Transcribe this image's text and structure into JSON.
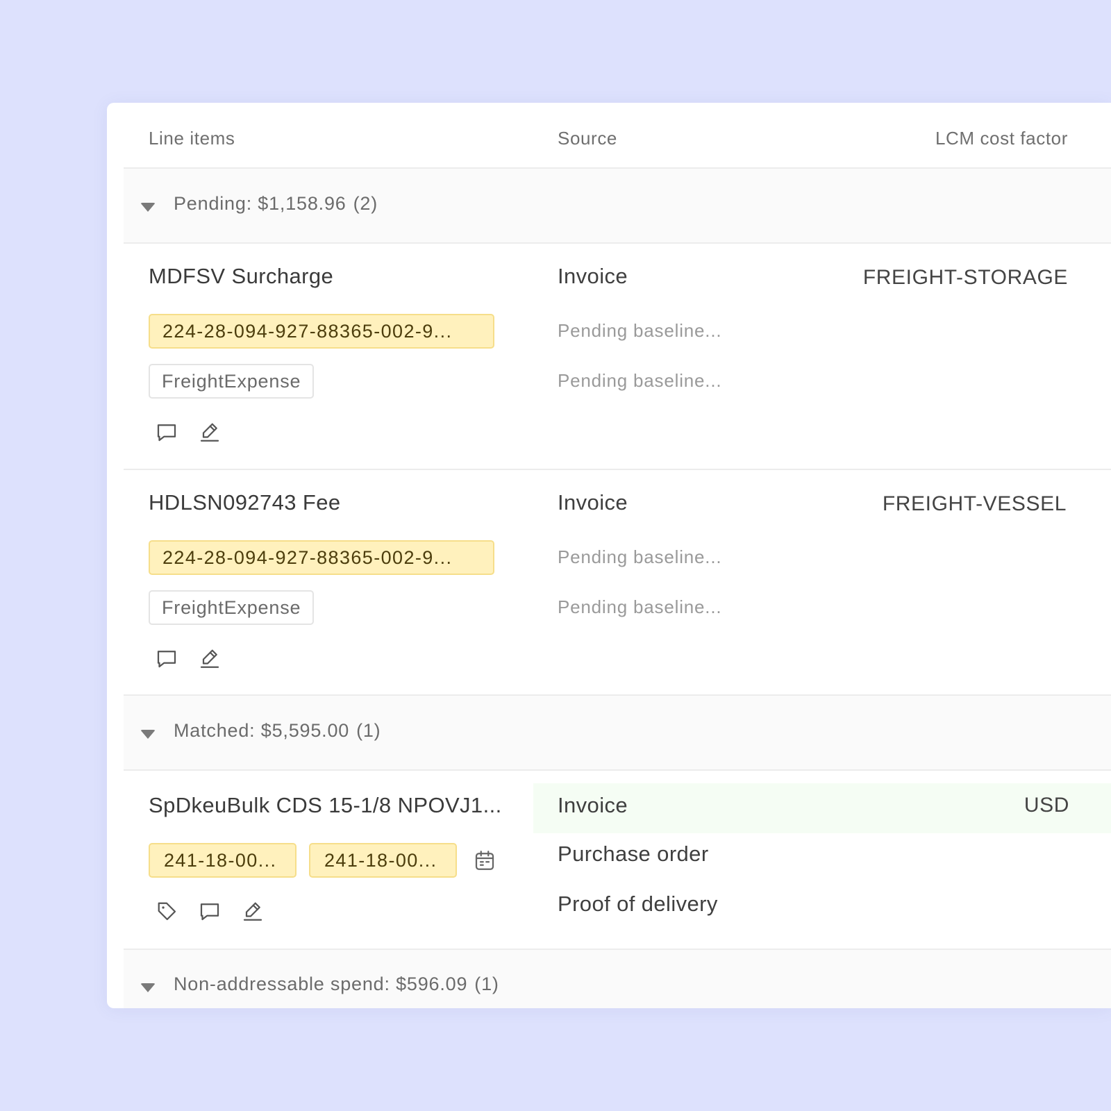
{
  "columns": {
    "line_items": "Line items",
    "source": "Source",
    "lcm_cost_factor": "LCM cost factor"
  },
  "groups": {
    "pending": {
      "label": "Pending: $1,158.96",
      "count": "(2)"
    },
    "matched": {
      "label": "Matched: $5,595.00",
      "count": "(1)"
    },
    "non_addressable": {
      "label": "Non-addressable spend: $596.09",
      "count": "(1)"
    }
  },
  "rows": [
    {
      "title": "MDFSV Surcharge",
      "reference": "224-28-094-927-88365-002-9...",
      "category": "FreightExpense",
      "source": "Invoice",
      "pending_1": "Pending baseline...",
      "pending_2": "Pending baseline...",
      "cost_factor": "FREIGHT-STORAGE"
    },
    {
      "title": "HDLSN092743 Fee",
      "reference": "224-28-094-927-88365-002-9...",
      "category": "FreightExpense",
      "source": "Invoice",
      "pending_1": "Pending baseline...",
      "pending_2": "Pending baseline...",
      "cost_factor": "FREIGHT-VESSEL"
    },
    {
      "title": "SpDkeuBulk CDS 15-1/8 NPOVJ1...",
      "reference_1": "241-18-00...",
      "reference_2": "241-18-00...",
      "source_1": "Invoice",
      "source_2": "Purchase order",
      "source_3": "Proof of delivery",
      "cost_factor": "USD"
    }
  ],
  "icons": {
    "comment": "comment-icon",
    "edit": "pencil-icon",
    "tag": "tag-icon",
    "calendar": "calendar-icon",
    "caret": "caret-down-icon"
  },
  "colors": {
    "background": "#dde1fd",
    "chip_yellow": "#fff1bd",
    "matched_highlight": "#f5fdf4"
  }
}
